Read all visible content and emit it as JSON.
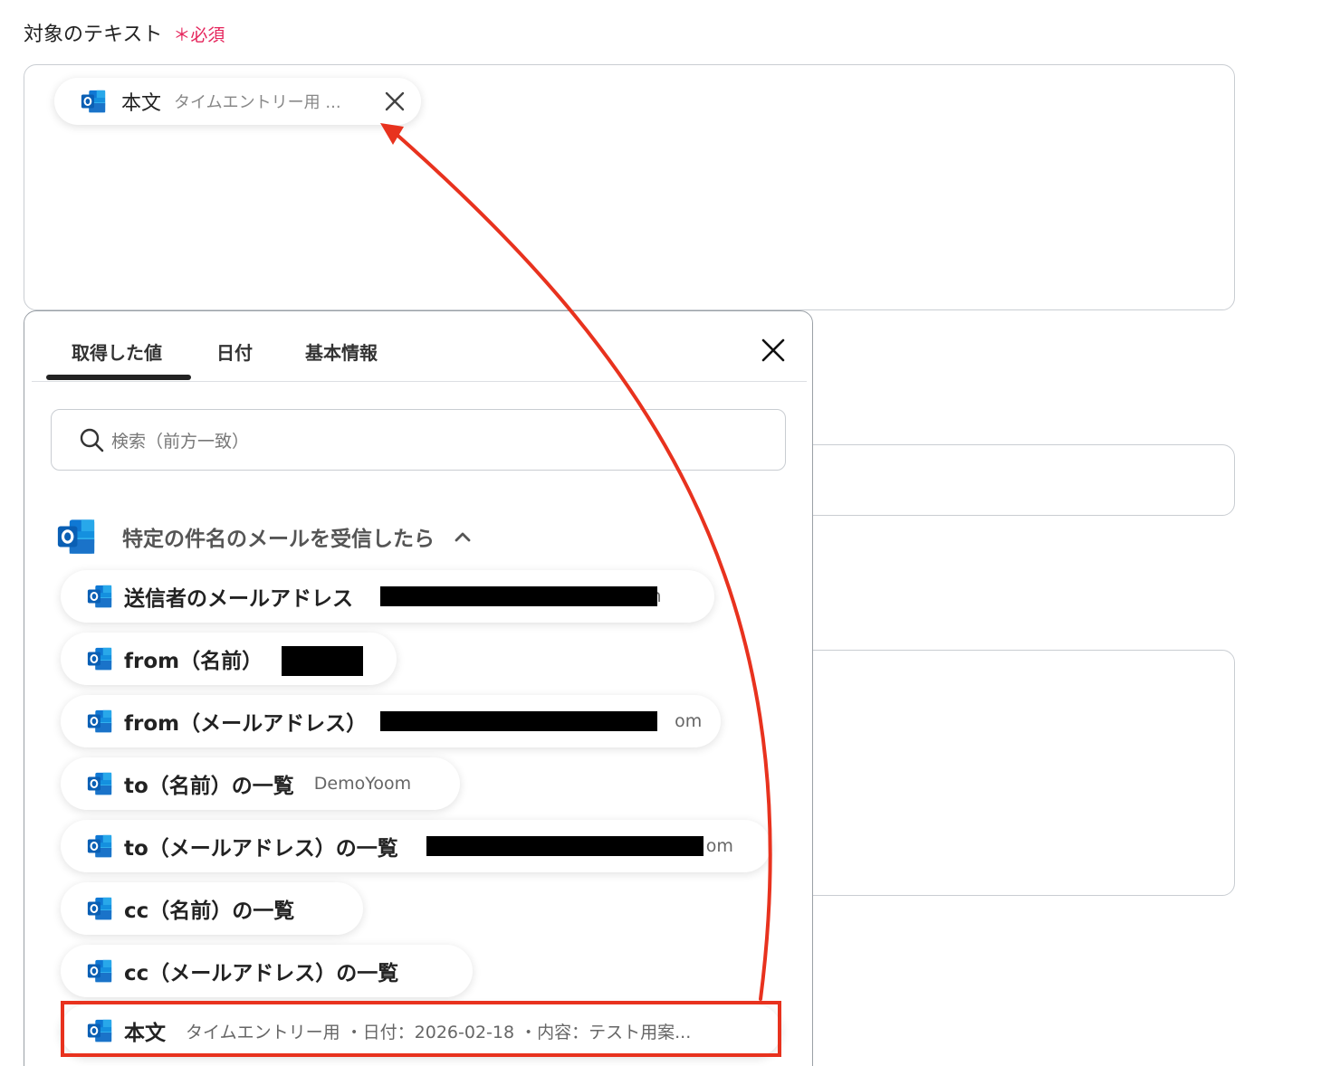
{
  "field": {
    "label": "対象のテキスト",
    "required": "＊必須"
  },
  "selected_chip": {
    "title": "本文",
    "value": "タイムエントリー用 ..."
  },
  "panel": {
    "tabs": [
      "取得した値",
      "日付",
      "基本情報"
    ],
    "search_placeholder": "検索（前方一致）",
    "group_title": "特定の件名のメールを受信したら",
    "items": [
      {
        "title": "送信者のメールアドレス",
        "value": "m"
      },
      {
        "title": "from（名前）",
        "value": ""
      },
      {
        "title": "from（メールアドレス）",
        "value": "om"
      },
      {
        "title": "to（名前）の一覧",
        "value": "DemoYoom"
      },
      {
        "title": "to（メールアドレス）の一覧",
        "value": "om"
      },
      {
        "title": "cc（名前）の一覧",
        "value": ""
      },
      {
        "title": "cc（メールアドレス）の一覧",
        "value": ""
      },
      {
        "title": "本文",
        "value": "タイムエントリー用 ・日付：2026-02-18 ・内容：テスト用案..."
      }
    ]
  },
  "icons": {
    "app_icon": "outlook-icon",
    "accent_arrow": "#e8321e"
  }
}
